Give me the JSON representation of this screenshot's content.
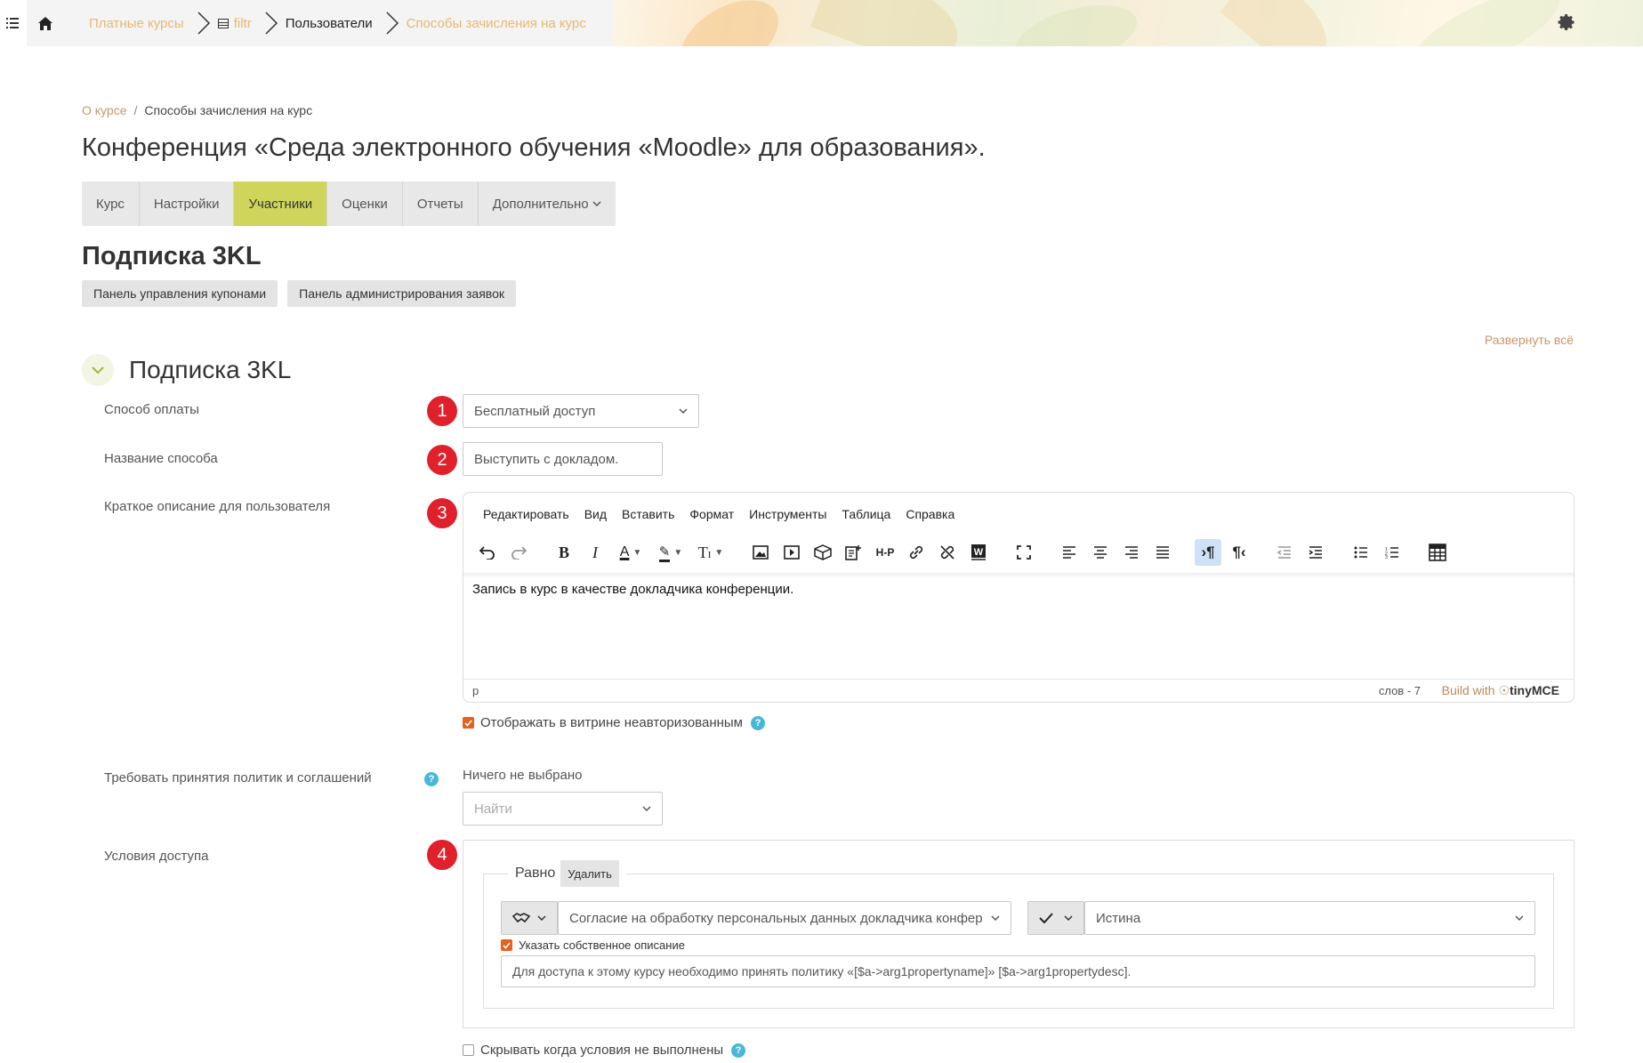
{
  "topbar": {
    "crumbs": [
      "Платные курсы",
      "filtr",
      "Пользователи",
      "Способы зачисления на курс"
    ]
  },
  "breadcrumb": {
    "link": "О курсе",
    "sep": "/",
    "current": "Способы зачисления на курс"
  },
  "course_title": "Конференция «Среда электронного обучения «Moodle» для образования».",
  "tabs": [
    "Курс",
    "Настройки",
    "Участники",
    "Оценки",
    "Отчеты",
    "Дополнительно"
  ],
  "active_tab": "Участники",
  "section_title": "Подписка 3KL",
  "buttons": {
    "coupons": "Панель управления купонами",
    "requests": "Панель администрирования заявок",
    "expand_all": "Развернуть всё",
    "delete": "Удалить"
  },
  "fieldset_title": "Подписка 3KL",
  "form": {
    "payment_label": "Способ оплаты",
    "payment_value": "Бесплатный доступ",
    "name_label": "Название способа",
    "name_value": "Выступить с докладом.",
    "desc_label": "Краткое описание для пользователя",
    "policies_label": "Требовать принятия политик и соглашений",
    "policies_selected": "Ничего не выбрано",
    "policies_search_placeholder": "Найти",
    "access_label": "Условия доступа",
    "show_unauth": "Отображать в витрине неавторизованным",
    "hide_unmet": "Скрывать когда условия не выполнены"
  },
  "badges": [
    "1",
    "2",
    "3",
    "4"
  ],
  "editor": {
    "menu": [
      "Редактировать",
      "Вид",
      "Вставить",
      "Формат",
      "Инструменты",
      "Таблица",
      "Справка"
    ],
    "content": "Запись в курс в качестве докладчика конференции.",
    "path": "p",
    "words": "слов - 7",
    "built_with": "Build with",
    "brand": "tinyMCE",
    "hp_label": "H-P"
  },
  "condition": {
    "label": "Равно",
    "field_value": "Согласие на обработку персональных данных докладчика конфер",
    "value": "Истина",
    "own_desc_label": "Указать собственное описание",
    "own_desc_value": "Для доступа к этому курсу необходимо принять политику «[$a->arg1propertyname]» [$a->arg1propertydesc]."
  },
  "checkboxes": {
    "show_unauth": true,
    "own_desc": true,
    "hide_unmet": false
  },
  "colors": {
    "accent_active_tab": "#cfd55a",
    "link": "#c7966a",
    "badge": "#e0202a",
    "checkbox": "#e8601c",
    "help": "#4ab7d8"
  },
  "icons": [
    "menu-icon",
    "home-icon",
    "gear-icon",
    "chevron-down-icon",
    "undo-icon",
    "redo-icon",
    "bold-icon",
    "italic-icon",
    "text-color-icon",
    "highlight-icon",
    "font-size-icon",
    "image-icon",
    "media-icon",
    "3d-box-icon",
    "doc-icon",
    "h5p-icon",
    "link-icon",
    "unlink-icon",
    "word-icon",
    "fullscreen-icon",
    "align-left-icon",
    "align-center-icon",
    "align-right-icon",
    "justify-icon",
    "ltr-icon",
    "rtl-icon",
    "outdent-icon",
    "indent-icon",
    "bullet-list-icon",
    "number-list-icon",
    "calculator-icon",
    "help-icon",
    "handshake-icon",
    "checkmark-icon"
  ]
}
